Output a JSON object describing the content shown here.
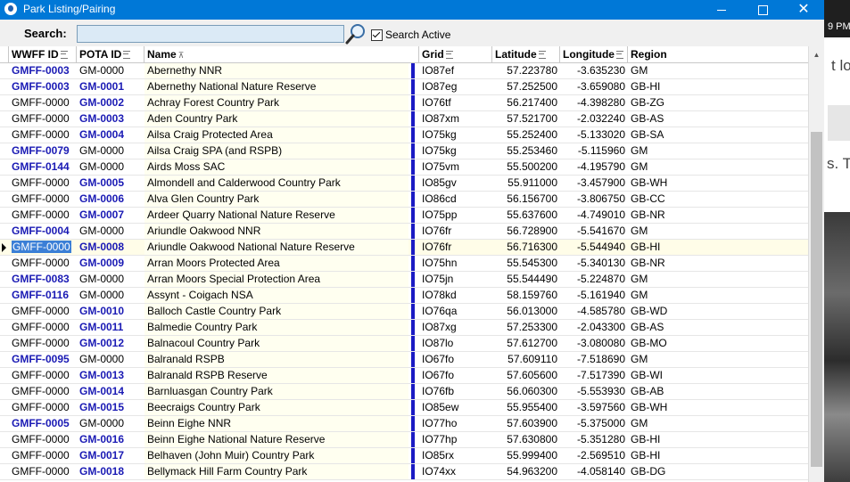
{
  "window": {
    "title": "Park Listing/Pairing",
    "min_icon": "minimize-icon",
    "max_icon": "maximize-icon",
    "close_icon": "close-icon",
    "app_icon": "app-icon"
  },
  "search": {
    "label": "Search:",
    "value": "",
    "placeholder": "",
    "button_icon": "magnifier-icon",
    "active_label": "Search Active",
    "active_checked": true
  },
  "columns": {
    "wwff": "WWFF ID",
    "pota": "POTA ID",
    "name": "Name",
    "grid": "Grid",
    "lat": "Latitude",
    "lon": "Longitude",
    "region": "Region"
  },
  "rows": [
    {
      "wwff": "GMFF-0003",
      "pota": "GM-0000",
      "name": "Abernethy NNR",
      "grid": "IO87ef",
      "lat": "57.223780",
      "lon": "-3.635230",
      "region": "GM",
      "wwff_link": true,
      "pota_link": false,
      "flag": "green"
    },
    {
      "wwff": "GMFF-0003",
      "pota": "GM-0001",
      "name": "Abernethy National Nature Reserve",
      "grid": "IO87eg",
      "lat": "57.252500",
      "lon": "-3.659080",
      "region": "GB-HI",
      "wwff_link": true,
      "pota_link": true,
      "flag": "blue"
    },
    {
      "wwff": "GMFF-0000",
      "pota": "GM-0002",
      "name": "Achray Forest Country Park",
      "grid": "IO76tf",
      "lat": "56.217400",
      "lon": "-4.398280",
      "region": "GB-ZG",
      "wwff_link": false,
      "pota_link": true,
      "flag": "blue"
    },
    {
      "wwff": "GMFF-0000",
      "pota": "GM-0003",
      "name": "Aden Country Park",
      "grid": "IO87xm",
      "lat": "57.521700",
      "lon": "-2.032240",
      "region": "GB-AS",
      "wwff_link": false,
      "pota_link": true,
      "flag": "blue"
    },
    {
      "wwff": "GMFF-0000",
      "pota": "GM-0004",
      "name": "Ailsa Craig Protected Area",
      "grid": "IO75kg",
      "lat": "55.252400",
      "lon": "-5.133020",
      "region": "GB-SA",
      "wwff_link": false,
      "pota_link": true,
      "flag": "blue"
    },
    {
      "wwff": "GMFF-0079",
      "pota": "GM-0000",
      "name": "Ailsa Craig SPA (and RSPB)",
      "grid": "IO75kg",
      "lat": "55.253460",
      "lon": "-5.115960",
      "region": "GM",
      "wwff_link": true,
      "pota_link": false,
      "flag": "blue"
    },
    {
      "wwff": "GMFF-0144",
      "pota": "GM-0000",
      "name": "Airds Moss SAC",
      "grid": "IO75vm",
      "lat": "55.500200",
      "lon": "-4.195790",
      "region": "GM",
      "wwff_link": true,
      "pota_link": false,
      "flag": "blue"
    },
    {
      "wwff": "GMFF-0000",
      "pota": "GM-0005",
      "name": "Almondell and Calderwood Country Park",
      "grid": "IO85gv",
      "lat": "55.911000",
      "lon": "-3.457900",
      "region": "GB-WH",
      "wwff_link": false,
      "pota_link": true,
      "flag": "blue"
    },
    {
      "wwff": "GMFF-0000",
      "pota": "GM-0006",
      "name": "Alva Glen Country Park",
      "grid": "IO86cd",
      "lat": "56.156700",
      "lon": "-3.806750",
      "region": "GB-CC",
      "wwff_link": false,
      "pota_link": true,
      "flag": "blue"
    },
    {
      "wwff": "GMFF-0000",
      "pota": "GM-0007",
      "name": "Ardeer Quarry National Nature Reserve",
      "grid": "IO75pp",
      "lat": "55.637600",
      "lon": "-4.749010",
      "region": "GB-NR",
      "wwff_link": false,
      "pota_link": true,
      "flag": "blue"
    },
    {
      "wwff": "GMFF-0004",
      "pota": "GM-0000",
      "name": "Ariundle Oakwood NNR",
      "grid": "IO76fr",
      "lat": "56.728900",
      "lon": "-5.541670",
      "region": "GM",
      "wwff_link": true,
      "pota_link": false,
      "flag": "blue"
    },
    {
      "wwff": "GMFF-0000",
      "pota": "GM-0008",
      "name": "Ariundle Oakwood National Nature Reserve",
      "grid": "IO76fr",
      "lat": "56.716300",
      "lon": "-5.544940",
      "region": "GB-HI",
      "wwff_link": false,
      "pota_link": true,
      "flag": "blue",
      "selected": true
    },
    {
      "wwff": "GMFF-0000",
      "pota": "GM-0009",
      "name": "Arran Moors Protected Area",
      "grid": "IO75hn",
      "lat": "55.545300",
      "lon": "-5.340130",
      "region": "GB-NR",
      "wwff_link": false,
      "pota_link": true,
      "flag": "blue"
    },
    {
      "wwff": "GMFF-0083",
      "pota": "GM-0000",
      "name": "Arran Moors Special Protection Area",
      "grid": "IO75jn",
      "lat": "55.544490",
      "lon": "-5.224870",
      "region": "GM",
      "wwff_link": true,
      "pota_link": false,
      "flag": "blue"
    },
    {
      "wwff": "GMFF-0116",
      "pota": "GM-0000",
      "name": "Assynt - Coigach NSA",
      "grid": "IO78kd",
      "lat": "58.159760",
      "lon": "-5.161940",
      "region": "GM",
      "wwff_link": true,
      "pota_link": false,
      "flag": "blue"
    },
    {
      "wwff": "GMFF-0000",
      "pota": "GM-0010",
      "name": "Balloch Castle Country Park",
      "grid": "IO76qa",
      "lat": "56.013000",
      "lon": "-4.585780",
      "region": "GB-WD",
      "wwff_link": false,
      "pota_link": true,
      "flag": "blue"
    },
    {
      "wwff": "GMFF-0000",
      "pota": "GM-0011",
      "name": "Balmedie Country Park",
      "grid": "IO87xg",
      "lat": "57.253300",
      "lon": "-2.043300",
      "region": "GB-AS",
      "wwff_link": false,
      "pota_link": true,
      "flag": "blue"
    },
    {
      "wwff": "GMFF-0000",
      "pota": "GM-0012",
      "name": "Balnacoul Country Park",
      "grid": "IO87lo",
      "lat": "57.612700",
      "lon": "-3.080080",
      "region": "GB-MO",
      "wwff_link": false,
      "pota_link": true,
      "flag": "blue"
    },
    {
      "wwff": "GMFF-0095",
      "pota": "GM-0000",
      "name": "Balranald RSPB",
      "grid": "IO67fo",
      "lat": "57.609110",
      "lon": "-7.518690",
      "region": "GM",
      "wwff_link": true,
      "pota_link": false,
      "flag": "blue"
    },
    {
      "wwff": "GMFF-0000",
      "pota": "GM-0013",
      "name": "Balranald RSPB Reserve",
      "grid": "IO67fo",
      "lat": "57.605600",
      "lon": "-7.517390",
      "region": "GB-WI",
      "wwff_link": false,
      "pota_link": true,
      "flag": "blue"
    },
    {
      "wwff": "GMFF-0000",
      "pota": "GM-0014",
      "name": "Barnluasgan Country Park",
      "grid": "IO76fb",
      "lat": "56.060300",
      "lon": "-5.553930",
      "region": "GB-AB",
      "wwff_link": false,
      "pota_link": true,
      "flag": "blue"
    },
    {
      "wwff": "GMFF-0000",
      "pota": "GM-0015",
      "name": "Beecraigs Country Park",
      "grid": "IO85ew",
      "lat": "55.955400",
      "lon": "-3.597560",
      "region": "GB-WH",
      "wwff_link": false,
      "pota_link": true,
      "flag": "blue"
    },
    {
      "wwff": "GMFF-0005",
      "pota": "GM-0000",
      "name": "Beinn Eighe NNR",
      "grid": "IO77ho",
      "lat": "57.603900",
      "lon": "-5.375000",
      "region": "GM",
      "wwff_link": true,
      "pota_link": false,
      "flag": "blue"
    },
    {
      "wwff": "GMFF-0000",
      "pota": "GM-0016",
      "name": "Beinn Eighe National Nature Reserve",
      "grid": "IO77hp",
      "lat": "57.630800",
      "lon": "-5.351280",
      "region": "GB-HI",
      "wwff_link": false,
      "pota_link": true,
      "flag": "blue"
    },
    {
      "wwff": "GMFF-0000",
      "pota": "GM-0017",
      "name": "Belhaven (John Muir) Country Park",
      "grid": "IO85rx",
      "lat": "55.999400",
      "lon": "-2.569510",
      "region": "GB-HI",
      "wwff_link": false,
      "pota_link": true,
      "flag": "blue"
    },
    {
      "wwff": "GMFF-0000",
      "pota": "GM-0018",
      "name": "Bellymack Hill Farm Country Park",
      "grid": "IO74xx",
      "lat": "54.963200",
      "lon": "-4.058140",
      "region": "GB-DG",
      "wwff_link": false,
      "pota_link": true,
      "flag": "blue"
    }
  ],
  "background": {
    "clock_text": "9 PM",
    "fragment_1": "t lor",
    "fragment_2": "s. Th"
  },
  "colors": {
    "titlebar": "#0078d7",
    "link": "#1a1ab4",
    "flag_blue": "#1b1bc4",
    "flag_green": "#15a035",
    "selection": "#3b7fd6"
  }
}
